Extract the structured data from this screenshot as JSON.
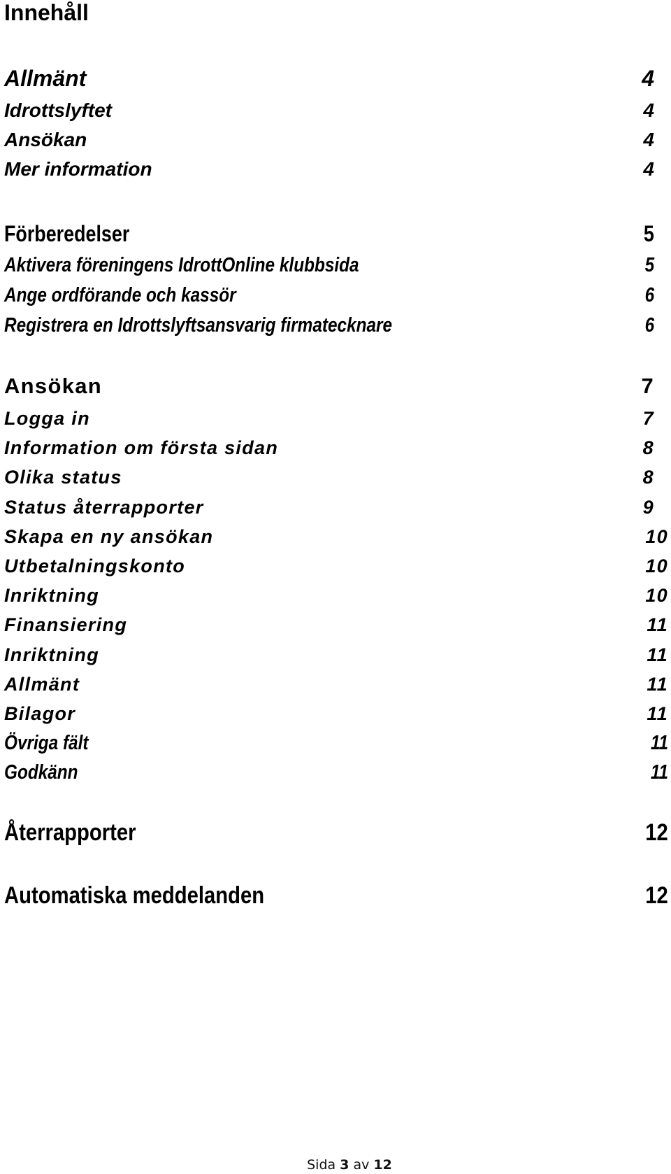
{
  "document": {
    "title": "Innehåll",
    "sections": [
      {
        "heading": {
          "label": "Allmänt",
          "page": "4"
        },
        "items": [
          {
            "label": "Idrottslyftet",
            "page": "4"
          },
          {
            "label": "Ansökan",
            "page": "4"
          },
          {
            "label": "Mer information",
            "page": "4"
          }
        ]
      },
      {
        "heading": {
          "label": "Förberedelser",
          "page": "5"
        },
        "items": [
          {
            "label": "Aktivera föreningens IdrottOnline klubbsida",
            "page": "5"
          },
          {
            "label": "Ange ordförande och kassör",
            "page": "6"
          },
          {
            "label": "Registrera en Idrottslyftsansvarig firmatecknare",
            "page": "6"
          }
        ]
      },
      {
        "heading": {
          "label": "Ansökan",
          "page": "7"
        },
        "items": [
          {
            "label": "Logga in",
            "page": "7"
          },
          {
            "label": "Information om första sidan",
            "page": "8"
          },
          {
            "label": "Olika status",
            "page": "8"
          },
          {
            "label": "Status återrapporter",
            "page": "9"
          },
          {
            "label": "Skapa en ny ansökan",
            "page": "10"
          },
          {
            "label": "Utbetalningskonto",
            "page": "10"
          },
          {
            "label": "Inriktning",
            "page": "10"
          },
          {
            "label": "Finansiering",
            "page": "11"
          },
          {
            "label": "Inriktning",
            "page": "11"
          },
          {
            "label": "Allmänt",
            "page": "11"
          },
          {
            "label": "Bilagor",
            "page": "11"
          },
          {
            "label": "Övriga fält",
            "page": "11"
          },
          {
            "label": "Godkänn",
            "page": "11"
          }
        ]
      },
      {
        "heading": {
          "label": "Återrapporter",
          "page": "12"
        },
        "items": []
      },
      {
        "heading": {
          "label": "Automatiska meddelanden",
          "page": "12"
        },
        "items": []
      }
    ]
  },
  "footer": {
    "prefix": "Sida",
    "current_page": "3",
    "separator": "av",
    "total_pages": "12"
  }
}
